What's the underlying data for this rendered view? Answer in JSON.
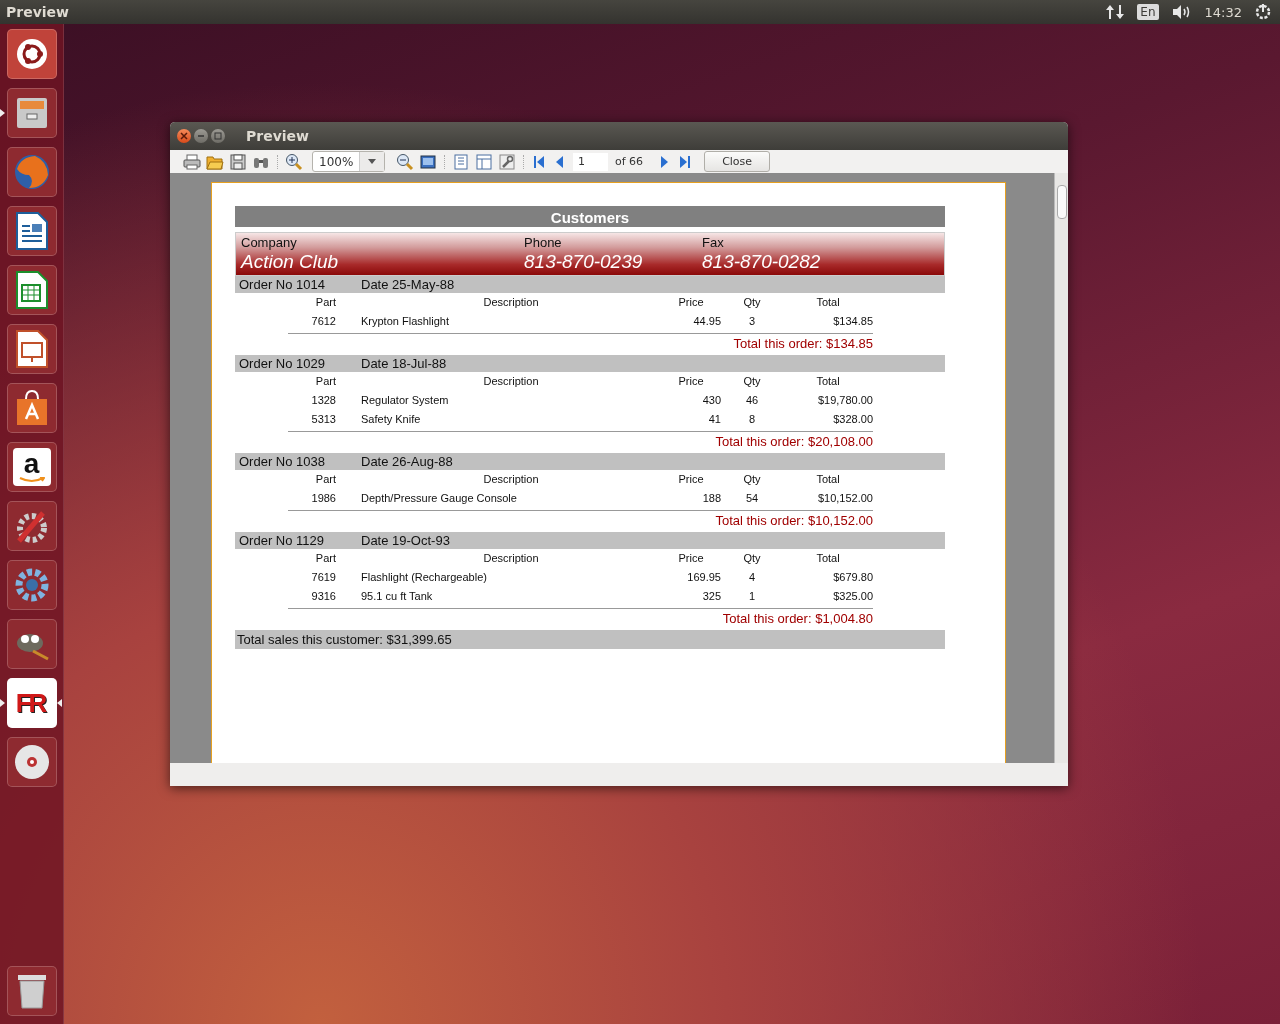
{
  "top_bar": {
    "app_title": "Preview",
    "keyboard_layout": "En",
    "clock": "14:32"
  },
  "launcher": [
    {
      "kind": "ubuntu",
      "running": false,
      "focused": false
    },
    {
      "kind": "files",
      "running": true,
      "focused": false
    },
    {
      "kind": "browser",
      "running": false,
      "focused": false
    },
    {
      "kind": "writer",
      "running": false,
      "focused": false
    },
    {
      "kind": "calc",
      "running": false,
      "focused": false
    },
    {
      "kind": "impress",
      "running": false,
      "focused": false
    },
    {
      "kind": "store",
      "running": false,
      "focused": false
    },
    {
      "kind": "amazon",
      "glyph": "a",
      "running": false,
      "focused": false
    },
    {
      "kind": "settings",
      "running": false,
      "focused": false
    },
    {
      "kind": "tweak",
      "running": false,
      "focused": false
    },
    {
      "kind": "gimp",
      "running": false,
      "focused": false
    },
    {
      "kind": "report",
      "glyph": "FR",
      "running": true,
      "focused": true
    },
    {
      "kind": "disc",
      "running": false,
      "focused": false
    },
    {
      "kind": "trash",
      "running": false,
      "focused": false
    }
  ],
  "window": {
    "title": "Preview",
    "toolbar": {
      "zoom": "100%",
      "page": "1",
      "page_count": "of 66",
      "close_button": "Close"
    },
    "report": {
      "title": "Customers",
      "labels": {
        "company": "Company",
        "phone": "Phone",
        "fax": "Fax"
      },
      "customer": {
        "company": "Action Club",
        "phone": "813-870-0239",
        "fax": "813-870-0282"
      },
      "orders": [
        {
          "order_no": "Order No 1014",
          "date": "Date 25-May-88",
          "headings": [
            "Part",
            "Description",
            "Price",
            "Qty",
            "Total"
          ],
          "items": [
            {
              "part": "7612",
              "description": "Krypton Flashlight",
              "price": "44.95",
              "qty": "3",
              "total": "$134.85"
            }
          ],
          "order_total": "Total this order: $134.85"
        },
        {
          "order_no": "Order No 1029",
          "date": "Date 18-Jul-88",
          "headings": [
            "Part",
            "Description",
            "Price",
            "Qty",
            "Total"
          ],
          "items": [
            {
              "part": "1328",
              "description": "Regulator System",
              "price": "430",
              "qty": "46",
              "total": "$19,780.00"
            },
            {
              "part": "5313",
              "description": "Safety Knife",
              "price": "41",
              "qty": "8",
              "total": "$328.00"
            }
          ],
          "order_total": "Total this order: $20,108.00"
        },
        {
          "order_no": "Order No 1038",
          "date": "Date 26-Aug-88",
          "headings": [
            "Part",
            "Description",
            "Price",
            "Qty",
            "Total"
          ],
          "items": [
            {
              "part": "1986",
              "description": "Depth/Pressure Gauge Console",
              "price": "188",
              "qty": "54",
              "total": "$10,152.00"
            }
          ],
          "order_total": "Total this order: $10,152.00"
        },
        {
          "order_no": "Order No 1129",
          "date": "Date 19-Oct-93",
          "headings": [
            "Part",
            "Description",
            "Price",
            "Qty",
            "Total"
          ],
          "items": [
            {
              "part": "7619",
              "description": "Flashlight (Rechargeable)",
              "price": "169.95",
              "qty": "4",
              "total": "$679.80"
            },
            {
              "part": "9316",
              "description": "95.1 cu ft Tank",
              "price": "325",
              "qty": "1",
              "total": "$325.00"
            }
          ],
          "order_total": "Total this order: $1,004.80"
        }
      ],
      "customer_total": "Total sales this customer: $31,399.65"
    }
  }
}
